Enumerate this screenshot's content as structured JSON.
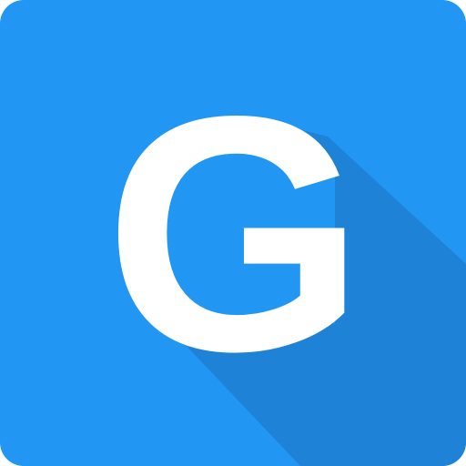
{
  "app_icon": {
    "letter": "G",
    "icon_name": "letter-g-app-icon",
    "colors": {
      "background": "#2196f3",
      "long_shadow": "#1e7fd4",
      "letter": "#ffffff"
    }
  }
}
